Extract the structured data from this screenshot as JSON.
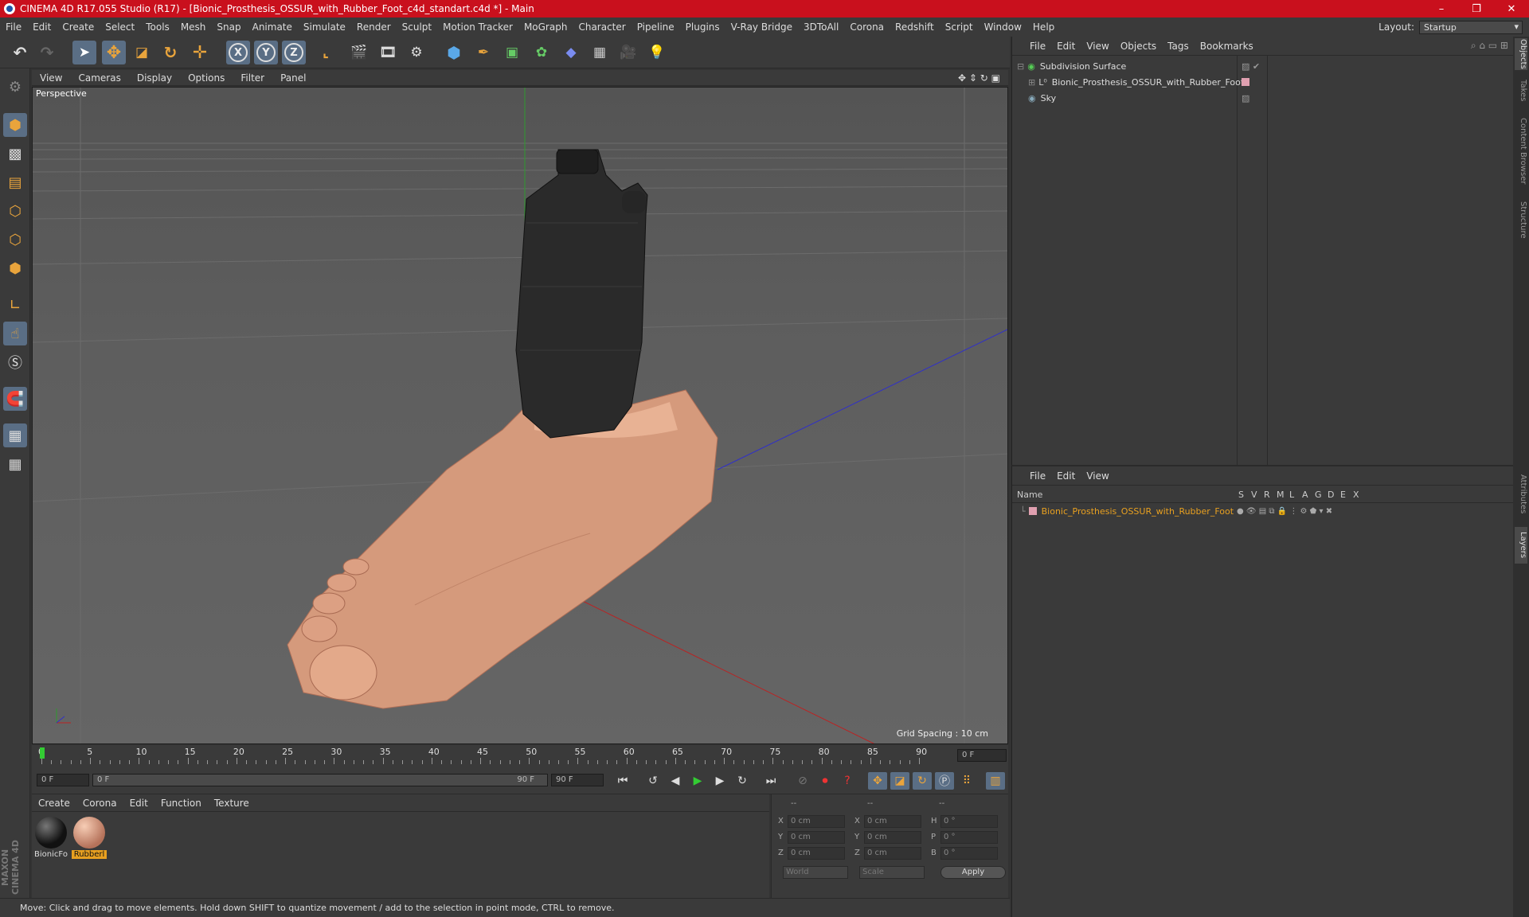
{
  "window": {
    "title": "CINEMA 4D R17.055 Studio (R17) - [Bionic_Prosthesis_OSSUR_with_Rubber_Foot_c4d_standart.c4d *] - Main"
  },
  "menu": [
    "File",
    "Edit",
    "Create",
    "Select",
    "Tools",
    "Mesh",
    "Snap",
    "Animate",
    "Simulate",
    "Render",
    "Sculpt",
    "Motion Tracker",
    "MoGraph",
    "Character",
    "Pipeline",
    "Plugins",
    "V-Ray Bridge",
    "3DToAll",
    "Corona",
    "Redshift",
    "Script",
    "Window",
    "Help"
  ],
  "layout": {
    "label": "Layout:",
    "value": "Startup"
  },
  "toolbar": {
    "axis_x": "X",
    "axis_y": "Y",
    "axis_z": "Z"
  },
  "viewport": {
    "menu": [
      "View",
      "Cameras",
      "Display",
      "Options",
      "Filter",
      "Panel"
    ],
    "label": "Perspective",
    "grid_spacing": "Grid Spacing : 10 cm"
  },
  "timeline": {
    "ticks": [
      "0",
      "5",
      "10",
      "15",
      "20",
      "25",
      "30",
      "35",
      "40",
      "45",
      "50",
      "55",
      "60",
      "65",
      "70",
      "75",
      "80",
      "85",
      "90"
    ],
    "current": "0 F",
    "start": "0 F",
    "range_start": "0 F",
    "range_end": "90 F",
    "end": "90 F"
  },
  "materials": {
    "menu": [
      "Create",
      "Corona",
      "Edit",
      "Function",
      "Texture"
    ],
    "items": [
      {
        "name": "BionicFo",
        "color": "#1a1a1a"
      },
      {
        "name": "Rubberl",
        "color": "#d9987a"
      }
    ]
  },
  "coords": {
    "headers": [
      "--",
      "--",
      "--"
    ],
    "rows": [
      {
        "a": "X",
        "av": "0 cm",
        "b": "X",
        "bv": "0 cm",
        "c": "H",
        "cv": "0 °"
      },
      {
        "a": "Y",
        "av": "0 cm",
        "b": "Y",
        "bv": "0 cm",
        "c": "P",
        "cv": "0 °"
      },
      {
        "a": "Z",
        "av": "0 cm",
        "b": "Z",
        "bv": "0 cm",
        "c": "B",
        "cv": "0 °"
      }
    ],
    "mode1": "World",
    "mode2": "Scale",
    "apply": "Apply"
  },
  "status": "Move: Click and drag to move elements. Hold down SHIFT to quantize movement / add to the selection in point mode, CTRL to remove.",
  "objects": {
    "menu": [
      "File",
      "Edit",
      "View",
      "Objects",
      "Tags",
      "Bookmarks"
    ],
    "items": [
      "Subdivision Surface",
      "Bionic_Prosthesis_OSSUR_with_Rubber_Foot",
      "Sky"
    ]
  },
  "layers": {
    "menu": [
      "File",
      "Edit",
      "View"
    ],
    "columns": [
      "Name",
      "S",
      "V",
      "R",
      "M",
      "L",
      "A",
      "G",
      "D",
      "E",
      "X"
    ],
    "items": [
      "Bionic_Prosthesis_OSSUR_with_Rubber_Foot"
    ],
    "accent": "#e8a020"
  },
  "right_tabs": [
    "Objects",
    "Takes",
    "Content Browser",
    "Structure",
    "Attributes",
    "Layers"
  ],
  "maxon": "MAXON CINEMA 4D"
}
